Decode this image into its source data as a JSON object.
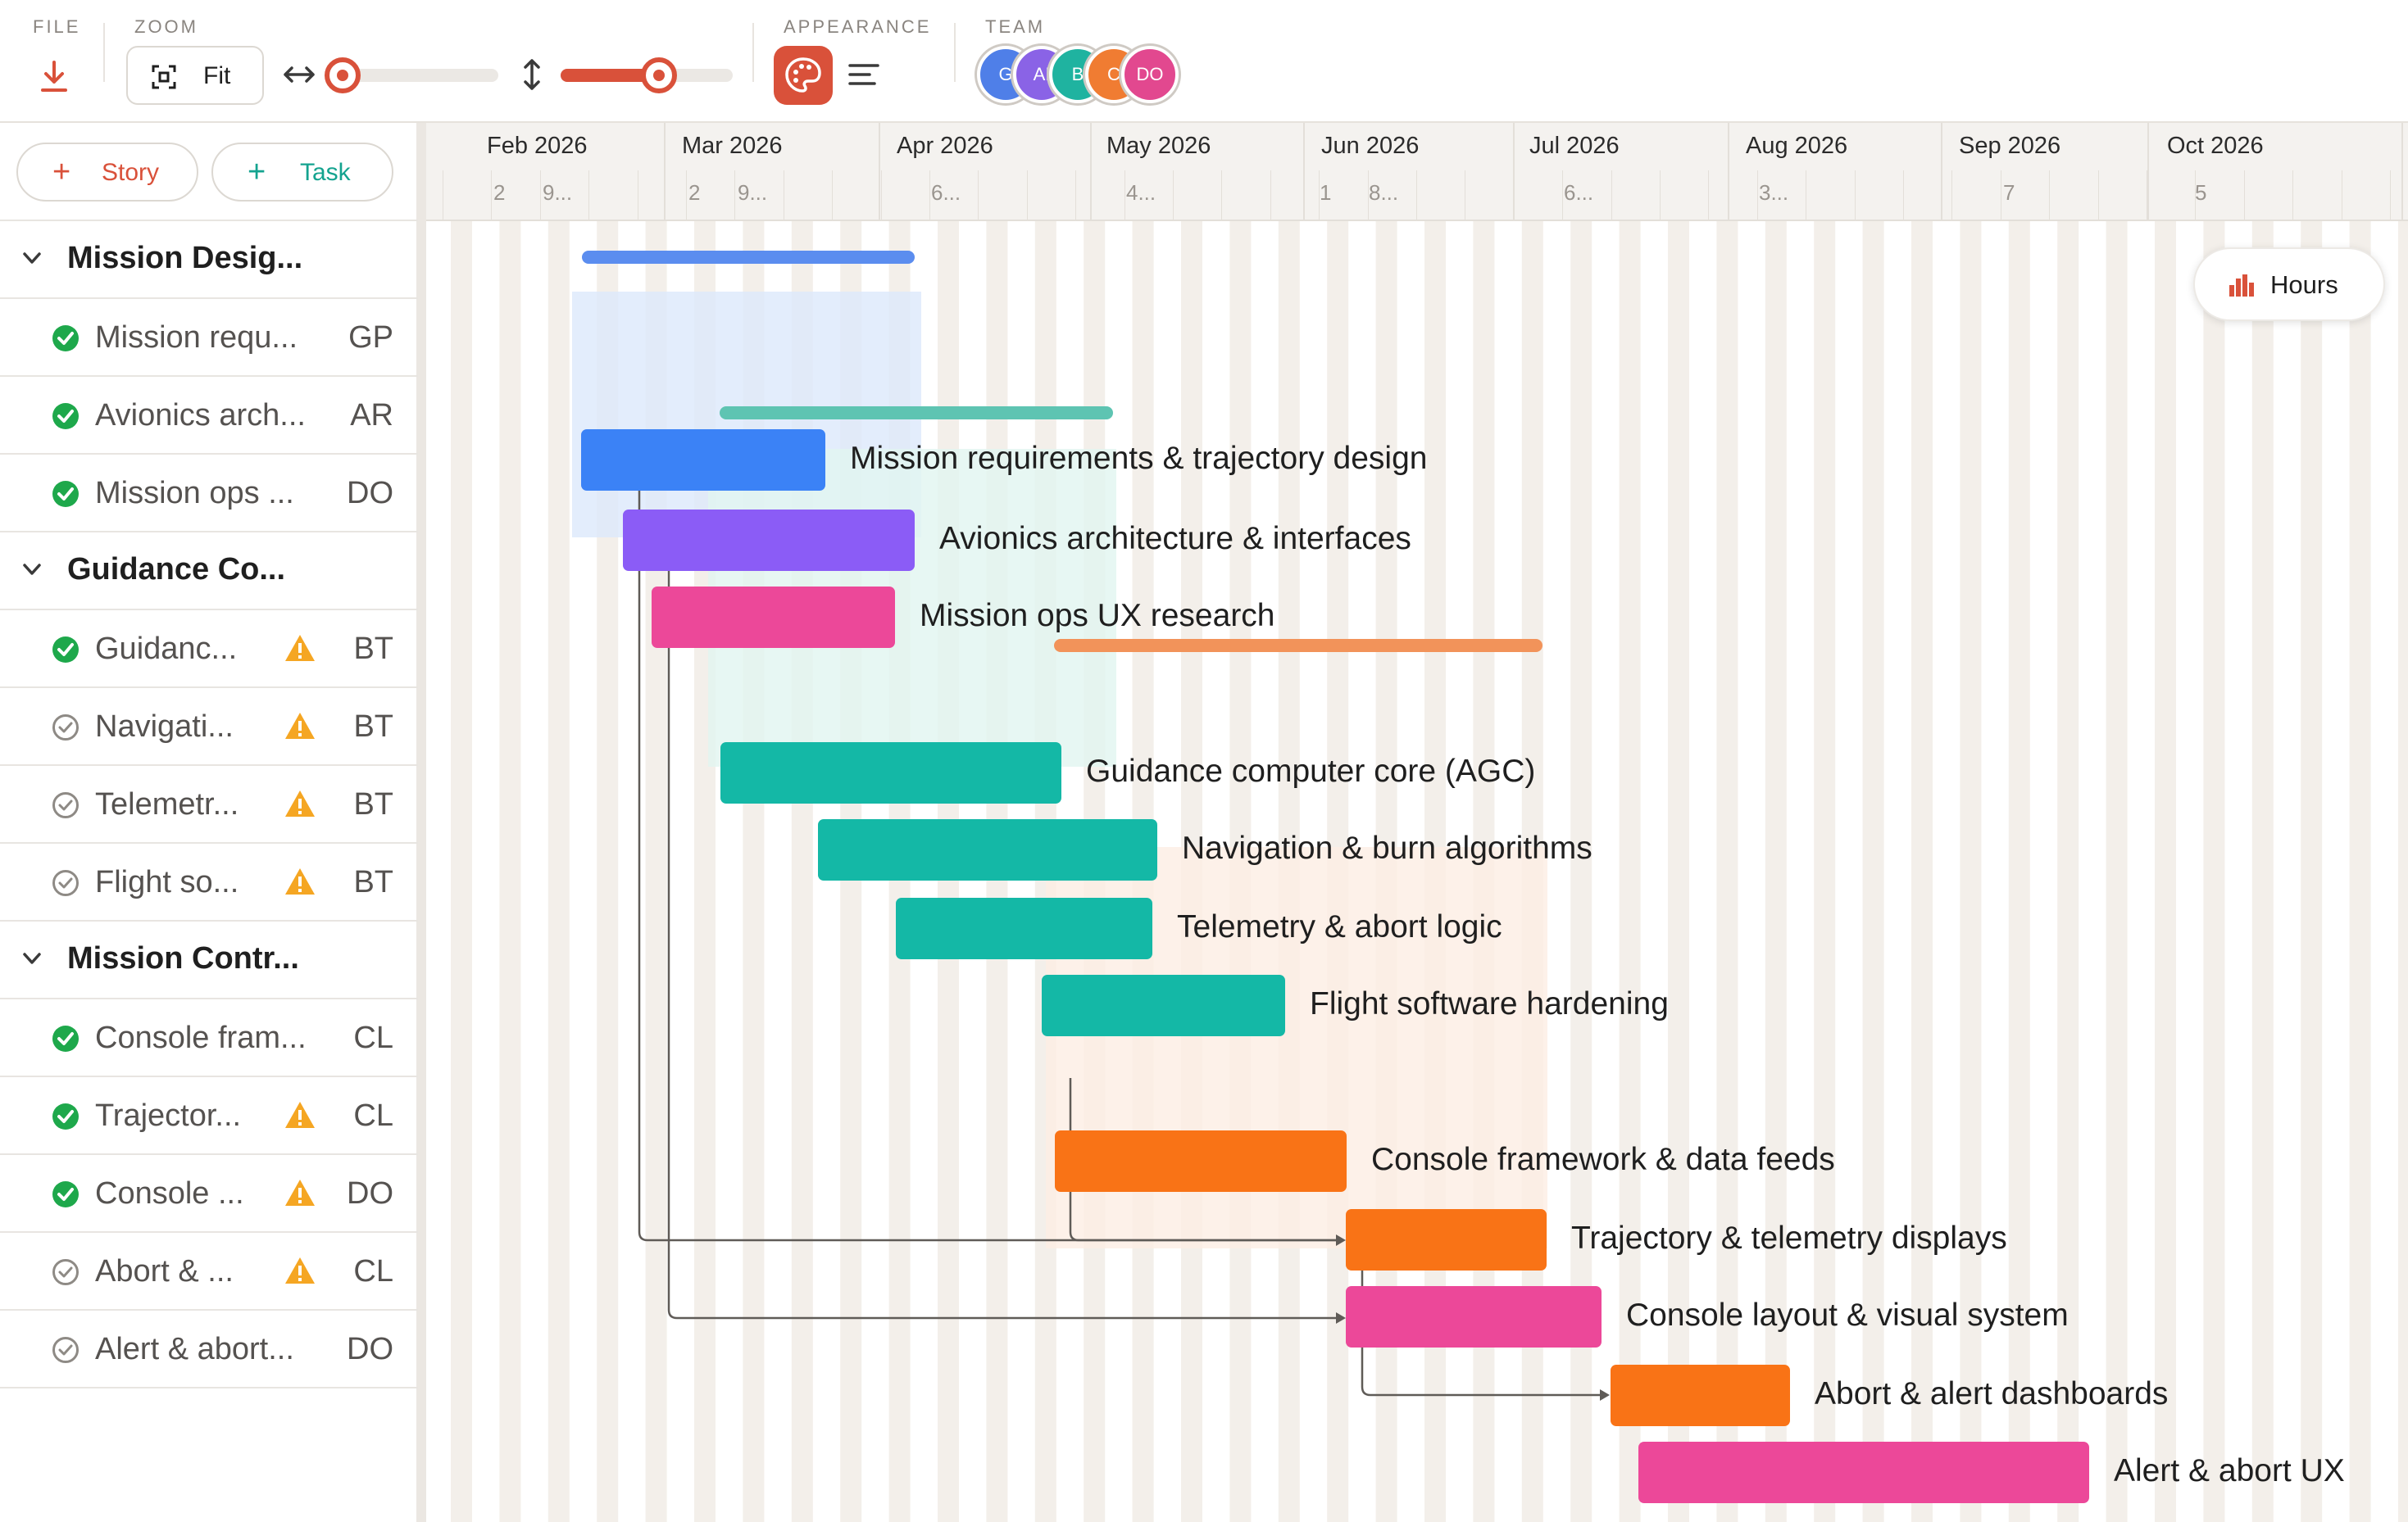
{
  "toolbar": {
    "file_label": "FILE",
    "zoom_label": "ZOOM",
    "fit_label": "Fit",
    "appearance_label": "APPEARANCE",
    "team_label": "TEAM",
    "horizontal_zoom_level": 0.07,
    "vertical_zoom_level": 0.57,
    "accent_color": "#d9513a",
    "team": [
      {
        "initials": "G",
        "color": "#4f7fe8"
      },
      {
        "initials": "AI",
        "color": "#8a63e6"
      },
      {
        "initials": "B",
        "color": "#1fb3a0"
      },
      {
        "initials": "C",
        "color": "#f07c32"
      },
      {
        "initials": "DO",
        "color": "#e2488f"
      }
    ]
  },
  "sidebar": {
    "add_story": "Story",
    "add_task": "Task",
    "groups": [
      {
        "name": "Mission Desig...",
        "tasks": [
          {
            "name": "Mission requ...",
            "owner": "GP",
            "done": true,
            "warning": false
          },
          {
            "name": "Avionics arch...",
            "owner": "AR",
            "done": true,
            "warning": false
          },
          {
            "name": "Mission ops ...",
            "owner": "DO",
            "done": true,
            "warning": false
          }
        ]
      },
      {
        "name": "Guidance Co...",
        "tasks": [
          {
            "name": "Guidanc...",
            "owner": "BT",
            "done": true,
            "warning": true
          },
          {
            "name": "Navigati...",
            "owner": "BT",
            "done": false,
            "warning": true
          },
          {
            "name": "Telemetr...",
            "owner": "BT",
            "done": false,
            "warning": true
          },
          {
            "name": "Flight so...",
            "owner": "BT",
            "done": false,
            "warning": true
          }
        ]
      },
      {
        "name": "Mission Contr...",
        "tasks": [
          {
            "name": "Console fram...",
            "owner": "CL",
            "done": true,
            "warning": false
          },
          {
            "name": "Trajector...",
            "owner": "CL",
            "done": true,
            "warning": true
          },
          {
            "name": "Console ...",
            "owner": "DO",
            "done": true,
            "warning": true
          },
          {
            "name": "Abort & ...",
            "owner": "CL",
            "done": false,
            "warning": true
          },
          {
            "name": "Alert & abort...",
            "owner": "DO",
            "done": false,
            "warning": false
          }
        ]
      }
    ]
  },
  "timeline": {
    "months": [
      "Feb 2026",
      "Mar 2026",
      "Apr 2026",
      "May 2026",
      "Jun 2026",
      "Jul 2026",
      "Aug 2026",
      "Sep 2026",
      "Oct 2026"
    ],
    "day_labels": [
      "2",
      "9...",
      "2",
      "9...",
      "6...",
      "4...",
      "1",
      "8...",
      "6...",
      "3...",
      "7",
      "5"
    ],
    "hours_label": "Hours",
    "bars": [
      {
        "name": "Mission requirements & trajectory design",
        "color": "#3b82f6"
      },
      {
        "name": "Avionics architecture & interfaces",
        "color": "#8b5cf6"
      },
      {
        "name": "Mission ops UX research",
        "color": "#ec4899"
      },
      {
        "name": "Guidance computer core (AGC)",
        "color": "#14b8a6"
      },
      {
        "name": "Navigation & burn algorithms",
        "color": "#14b8a6"
      },
      {
        "name": "Telemetry & abort logic",
        "color": "#14b8a6"
      },
      {
        "name": "Flight software hardening",
        "color": "#14b8a6"
      },
      {
        "name": "Console framework & data feeds",
        "color": "#f97316"
      },
      {
        "name": "Trajectory & telemetry displays",
        "color": "#f97316"
      },
      {
        "name": "Console layout & visual system",
        "color": "#ec4899"
      },
      {
        "name": "Abort & alert dashboards",
        "color": "#f97316"
      },
      {
        "name": "Alert & abort UX",
        "color": "#ec4899"
      }
    ],
    "group_colors": [
      "#5b8def",
      "#5ec4b2",
      "#f2935a"
    ]
  }
}
